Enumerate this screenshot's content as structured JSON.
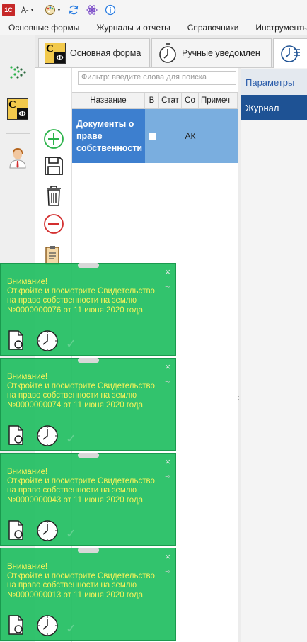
{
  "toolbar": {
    "logo_text": "1С",
    "buttons": [
      "1c-logo-icon",
      "text-format-icon",
      "palette-icon",
      "refresh-icon",
      "atom-icon",
      "info-icon"
    ]
  },
  "menu": {
    "items": [
      "Основные формы",
      "Журналы и отчеты",
      "Справочники",
      "Инструменты"
    ]
  },
  "sidebar": {
    "items": [
      "arrows-icon",
      "sf-document-icon",
      "user-avatar-icon"
    ]
  },
  "tabs": [
    {
      "label": "Основная форма",
      "icon": "sf-document-icon",
      "active": false
    },
    {
      "label": "Ручные уведомлен",
      "icon": "clock-icon",
      "active": false
    },
    {
      "label": "",
      "icon": "clock-list-icon",
      "active": true
    }
  ],
  "actions": [
    "add-icon",
    "save-icon",
    "delete-icon",
    "remove-icon",
    "paste-icon"
  ],
  "filter": {
    "placeholder": "Фильтр: введите слова для поиска"
  },
  "grid": {
    "columns": [
      "Название",
      "В",
      "Стат",
      "Со",
      "Примеч"
    ],
    "rows": [
      {
        "name": "Документы о праве собственности",
        "v_checked": false,
        "stat": "",
        "co": "АК",
        "note": ""
      }
    ]
  },
  "right_panel": {
    "params_label": "Параметры",
    "journal_label": "Журнал"
  },
  "notifications": [
    {
      "title": "Внимание!",
      "text": "Откройте и посмотрите Свидетельство на право собственности на землю №0000000076 от 11 июня 2020 года",
      "close": "×"
    },
    {
      "title": "Внимание!",
      "text": "Откройте и посмотрите Свидетельство на право собственности на землю №0000000074 от 11 июня 2020 года",
      "close": "×"
    },
    {
      "title": "Внимание!",
      "text": "Откройте и посмотрите Свидетельство на право собственности на землю №0000000043 от 11 июня 2020 года",
      "close": "×"
    },
    {
      "title": "Внимание!",
      "text": "Откройте и посмотрите Свидетельство на право собственности на землю №0000000013 от 11 июня 2020 года",
      "close": "×"
    }
  ],
  "colors": {
    "accent": "#1e5294",
    "selection": "#3d7fcf",
    "notification_bg": "#22be62",
    "notification_text": "#f7f35a"
  }
}
